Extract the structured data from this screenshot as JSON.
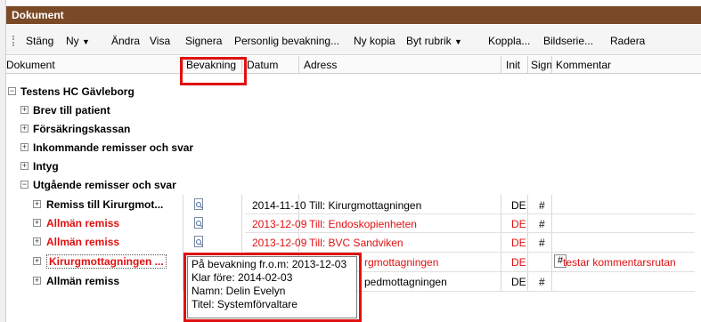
{
  "window": {
    "title": "Dokument"
  },
  "toolbar": {
    "items": [
      "Stäng",
      "Ny",
      "Ändra",
      "Visa",
      "Signera",
      "Personlig bevakning...",
      "Ny kopia",
      "Byt rubrik",
      "Koppla...",
      "Bildserie...",
      "Radera"
    ]
  },
  "columns": {
    "dokument": "Dokument",
    "bevakning": "Bevakning",
    "datum": "Datum",
    "adress": "Adress",
    "init": "Init",
    "sign": "Sign",
    "kommentar": "Kommentar"
  },
  "tree": {
    "root": "Testens HC Gävleborg",
    "groups": [
      "Brev till patient",
      "Försäkringskassan",
      "Inkommande remisser och svar",
      "Intyg",
      "Utgående remisser och svar"
    ],
    "rows": [
      {
        "name": "Remiss till Kirurgmot...",
        "datum": "2014-11-10",
        "adress": "Till: Kirurgmottagningen",
        "init": "DE",
        "sign": "#",
        "kommentar": "",
        "red": false
      },
      {
        "name": "Allmän remiss",
        "datum": "2013-12-09",
        "adress": "Till: Endoskopienheten",
        "init": "DE",
        "sign": "#",
        "kommentar": "",
        "red": true
      },
      {
        "name": "Allmän remiss",
        "datum": "2013-12-09",
        "adress": "Till: BVC Sandviken",
        "init": "DE",
        "sign": "#",
        "kommentar": "",
        "red": true
      },
      {
        "name": "Kirurgmottagningen ...",
        "datum": "",
        "adress": "rgmottagningen",
        "init": "DE",
        "sign": "#",
        "kommentar": "testar kommentarsrutan",
        "red": true
      },
      {
        "name": "Allmän remiss",
        "datum": "",
        "adress": "pedmottagningen",
        "init": "DE",
        "sign": "#",
        "kommentar": "",
        "red": false
      }
    ]
  },
  "tooltip": {
    "line1": "På bevakning fr.o.m: 2013-12-03",
    "line2": "Klar före: 2014-02-03",
    "line3": "Namn: Delin Evelyn",
    "line4": "Titel: Systemförvaltare"
  },
  "colors": {
    "titlebar": "#7a4a26",
    "highlight": "#e01010",
    "red_text": "#e01010"
  }
}
